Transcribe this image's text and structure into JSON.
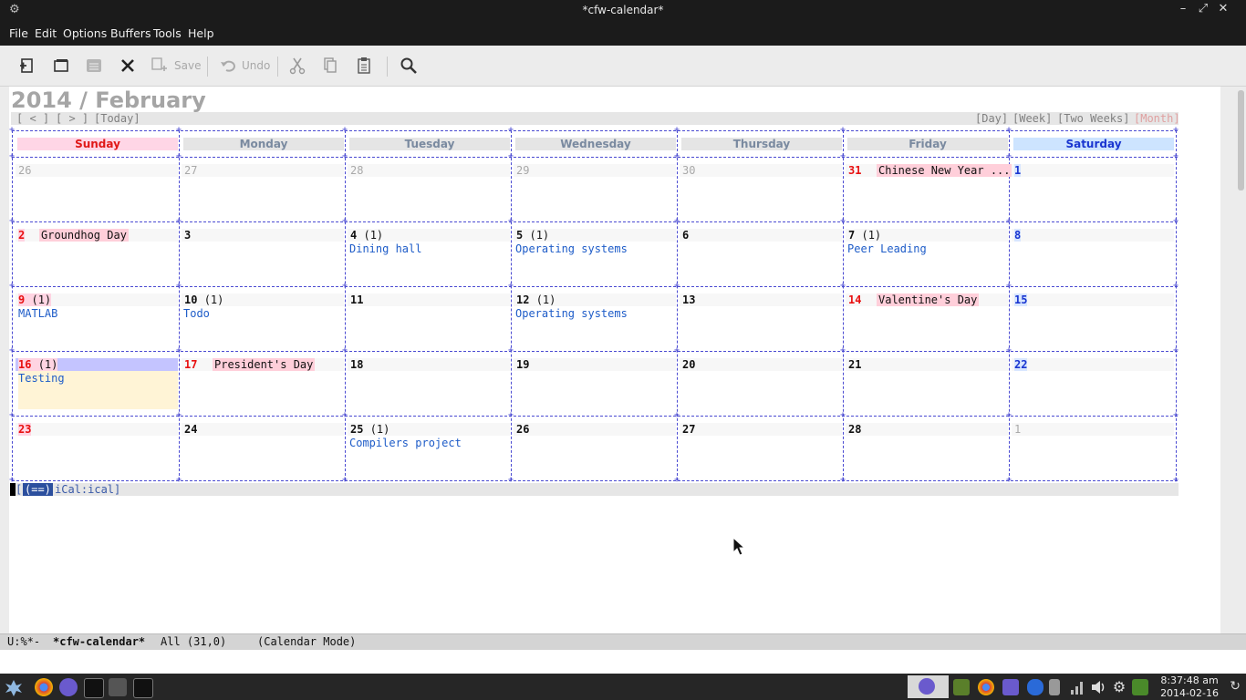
{
  "window": {
    "title": "*cfw-calendar*"
  },
  "menu": [
    "File",
    "Edit",
    "Options",
    "Buffers",
    "Tools",
    "Help"
  ],
  "toolbar": {
    "save_label": "Save",
    "undo_label": "Undo"
  },
  "calendar": {
    "heading": "2014 / February",
    "nav": {
      "prev": "[ < ]",
      "next": "[ > ]",
      "today": "[Today]",
      "day": "[Day]",
      "week": "[Week]",
      "two_weeks": "[Two Weeks]",
      "month": "[Month]"
    },
    "weekdays": [
      "Sunday",
      "Monday",
      "Tuesday",
      "Wednesday",
      "Thursday",
      "Friday",
      "Saturday"
    ],
    "weeks": [
      [
        {
          "day": "26",
          "other": true
        },
        {
          "day": "27",
          "other": true
        },
        {
          "day": "28",
          "other": true
        },
        {
          "day": "29",
          "other": true
        },
        {
          "day": "30",
          "other": true
        },
        {
          "day": "31",
          "holiday": "Chinese New Year ...",
          "red": true
        },
        {
          "day": "1",
          "blue": true
        }
      ],
      [
        {
          "day": "2",
          "holiday": "Groundhog Day",
          "red": true
        },
        {
          "day": "3"
        },
        {
          "day": "4",
          "count": "(1)",
          "event": "Dining hall"
        },
        {
          "day": "5",
          "count": "(1)",
          "event": "Operating systems"
        },
        {
          "day": "6"
        },
        {
          "day": "7",
          "count": "(1)",
          "event": "Peer Leading"
        },
        {
          "day": "8",
          "blue": true
        }
      ],
      [
        {
          "day": "9",
          "count": "(1)",
          "event": "MATLAB",
          "red": true
        },
        {
          "day": "10",
          "count": "(1)",
          "event": "Todo"
        },
        {
          "day": "11"
        },
        {
          "day": "12",
          "count": "(1)",
          "event": "Operating systems"
        },
        {
          "day": "13"
        },
        {
          "day": "14",
          "holiday": "Valentine's Day",
          "red": true
        },
        {
          "day": "15",
          "blue": true
        }
      ],
      [
        {
          "day": "16",
          "count": "(1)",
          "event": "Testing",
          "red": true,
          "today": true
        },
        {
          "day": "17",
          "holiday": "President's Day",
          "red": true
        },
        {
          "day": "18"
        },
        {
          "day": "19"
        },
        {
          "day": "20"
        },
        {
          "day": "21"
        },
        {
          "day": "22",
          "blue": true
        }
      ],
      [
        {
          "day": "23",
          "red": true
        },
        {
          "day": "24"
        },
        {
          "day": "25",
          "count": "(1)",
          "event": "Compilers project"
        },
        {
          "day": "26"
        },
        {
          "day": "27"
        },
        {
          "day": "28"
        },
        {
          "day": "1",
          "other": true
        }
      ]
    ],
    "buffer_line": {
      "tag": "(==)",
      "source": "iCal:ical"
    }
  },
  "modeline": {
    "status": "U:%*-",
    "buffer": "*cfw-calendar*",
    "position": "All (31,0)",
    "mode": "(Calendar Mode)"
  },
  "clock": {
    "time": "8:37:48 am",
    "date": "2014-02-16"
  },
  "colors": {
    "sunday": "#e01818",
    "saturday": "#1a36d0",
    "event": "#1e5cc8",
    "holiday_bg": "#ffcfda",
    "today_bg": "#c4c4ff",
    "gridline": "#4a4ad2"
  }
}
